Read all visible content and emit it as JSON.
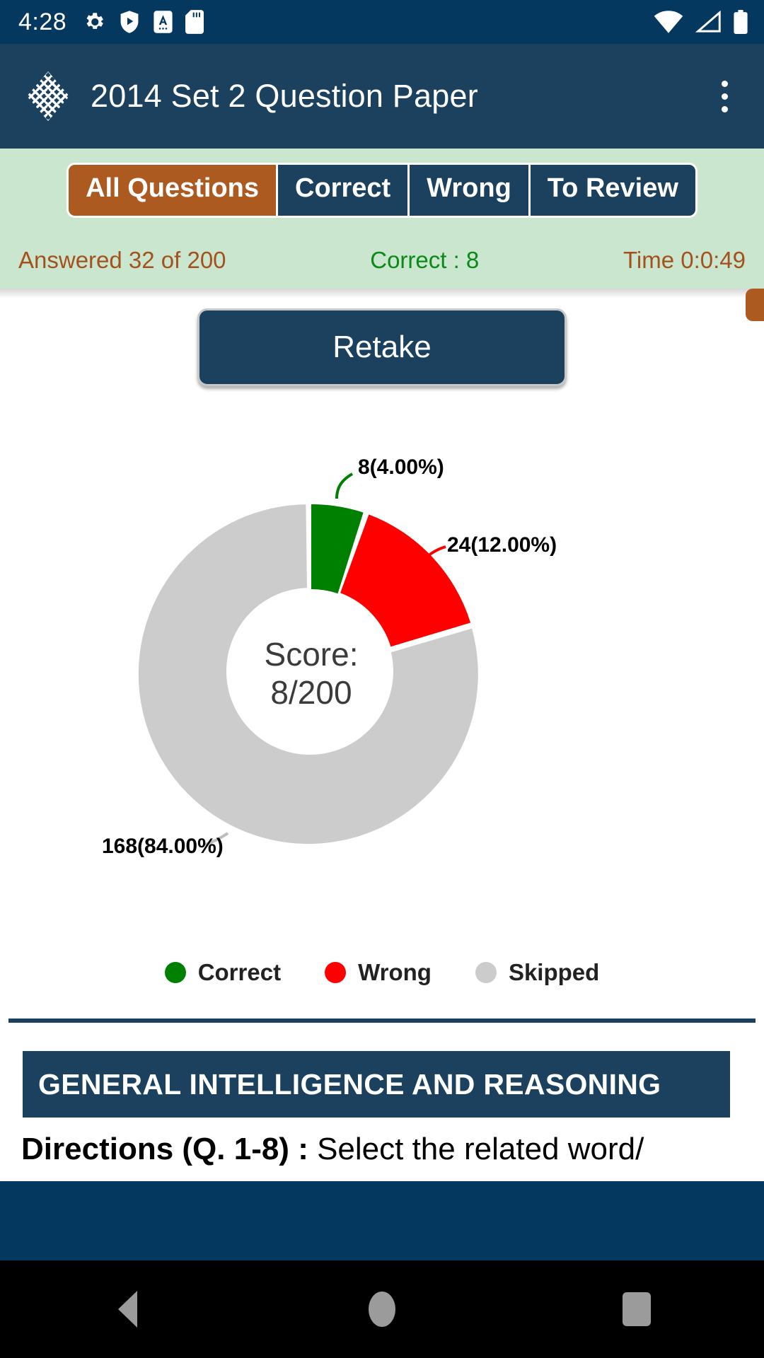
{
  "statusbar": {
    "time": "4:28",
    "left_icons": [
      "gear-icon",
      "shield-play-icon",
      "a-app-icon",
      "sd-card-icon"
    ],
    "right_icons": [
      "wifi-icon",
      "cell-signal-icon",
      "battery-icon"
    ]
  },
  "appbar": {
    "logo": "lattice-diamond-logo",
    "title": "2014 Set 2 Question Paper",
    "overflow": "more-options-icon"
  },
  "tabs": [
    {
      "label": "All Questions",
      "active": true
    },
    {
      "label": "Correct",
      "active": false
    },
    {
      "label": "Wrong",
      "active": false
    },
    {
      "label": "To Review",
      "active": false
    }
  ],
  "stats": {
    "answered": "Answered 32 of 200",
    "correct": "Correct : 8",
    "time": "Time 0:0:49"
  },
  "actions": {
    "retake": "Retake"
  },
  "score": {
    "line1": "Score:",
    "line2": "8/200"
  },
  "legend": [
    {
      "label": "Correct",
      "color": "#008000"
    },
    {
      "label": "Wrong",
      "color": "#fe0000"
    },
    {
      "label": "Skipped",
      "color": "#cccccc"
    }
  ],
  "paper": {
    "section_title": "GENERAL INTELLIGENCE AND REASONING",
    "directions_bold": "Directions (Q. 1-8) :",
    "directions_rest": " Select the related word/"
  },
  "navbar": {
    "back": "back-icon",
    "home": "home-icon",
    "recents": "recents-icon"
  },
  "colors": {
    "status_bar": "#05385f",
    "app_bar": "#1b415f",
    "tab_strip": "#cbe6ce",
    "accent_orange": "#ac5a20",
    "correct_green": "#0a8a16",
    "brown_text": "#a3521d"
  },
  "chart_data": {
    "type": "pie",
    "title": "Score: 8/200",
    "donut": true,
    "categories": [
      "Correct",
      "Wrong",
      "Skipped"
    ],
    "values": [
      8,
      24,
      168
    ],
    "percents": [
      4.0,
      12.0,
      84.0
    ],
    "colors": [
      "#008000",
      "#fe0000",
      "#cccccc"
    ],
    "labels": [
      "8(4.00%)",
      "24(12.00%)",
      "168(84.00%)"
    ],
    "total": 200,
    "start_angle_deg": 0,
    "legend_position": "bottom",
    "grid": false
  }
}
